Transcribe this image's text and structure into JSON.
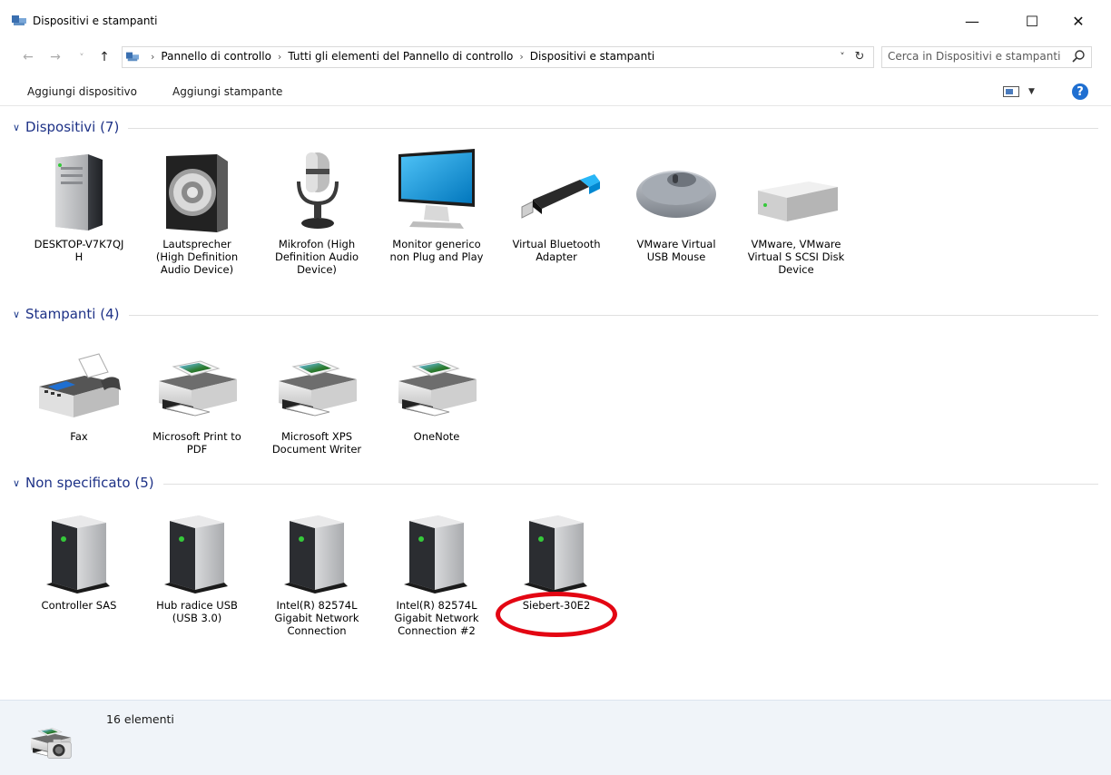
{
  "window": {
    "title": "Dispositivi e stampanti",
    "minimize_glyph": "—",
    "maximize_glyph": "☐",
    "close_glyph": "✕"
  },
  "navigation": {
    "back_glyph": "←",
    "forward_glyph": "→",
    "recent_glyph": "˅",
    "up_glyph": "↑",
    "breadcrumbs": [
      "Pannello di controllo",
      "Tutti gli elementi del Pannello di controllo",
      "Dispositivi e stampanti"
    ],
    "breadcrumb_separator": "›",
    "dropdown_glyph": "˅",
    "refresh_glyph": "↻"
  },
  "search": {
    "placeholder": "Cerca in Dispositivi e stampanti"
  },
  "toolbar": {
    "add_device_label": "Aggiungi dispositivo",
    "add_printer_label": "Aggiungi stampante",
    "view_dropdown_glyph": "▼",
    "help_glyph": "?"
  },
  "groups": {
    "devices": {
      "title": "Dispositivi (7)",
      "items": [
        {
          "label": "DESKTOP-V7K7QJ H",
          "icon": "computer-tower-icon"
        },
        {
          "label": "Lautsprecher (High Definition Audio Device)",
          "icon": "speaker-icon"
        },
        {
          "label": "Mikrofon (High Definition Audio Device)",
          "icon": "microphone-icon"
        },
        {
          "label": "Monitor generico non Plug and Play",
          "icon": "monitor-icon"
        },
        {
          "label": "Virtual Bluetooth Adapter",
          "icon": "usb-bluetooth-adapter-icon"
        },
        {
          "label": "VMware Virtual USB Mouse",
          "icon": "mouse-icon"
        },
        {
          "label": "VMware, VMware Virtual S SCSI Disk Device",
          "icon": "disk-drive-icon"
        }
      ]
    },
    "printers": {
      "title": "Stampanti (4)",
      "items": [
        {
          "label": "Fax",
          "icon": "fax-icon"
        },
        {
          "label": "Microsoft Print to PDF",
          "icon": "printer-icon"
        },
        {
          "label": "Microsoft XPS Document Writer",
          "icon": "printer-icon"
        },
        {
          "label": "OneNote",
          "icon": "printer-icon"
        }
      ]
    },
    "unspecified": {
      "title": "Non specificato (5)",
      "items": [
        {
          "label": "Controller SAS",
          "icon": "generic-device-icon"
        },
        {
          "label": "Hub radice USB (USB 3.0)",
          "icon": "generic-device-icon"
        },
        {
          "label": "Intel(R) 82574L Gigabit Network Connection",
          "icon": "generic-device-icon"
        },
        {
          "label": "Intel(R) 82574L Gigabit Network Connection #2",
          "icon": "generic-device-icon"
        },
        {
          "label": "Siebert-30E2",
          "icon": "generic-device-icon"
        }
      ]
    }
  },
  "highlight": {
    "color": "#e30613",
    "target": "Siebert-30E2"
  },
  "status": {
    "item_count": "16 elementi"
  },
  "colors": {
    "group_title": "#1e3287",
    "status_background": "#f0f4f9",
    "help_blue": "#1f6fd1",
    "device_led_green": "#35c93a"
  }
}
